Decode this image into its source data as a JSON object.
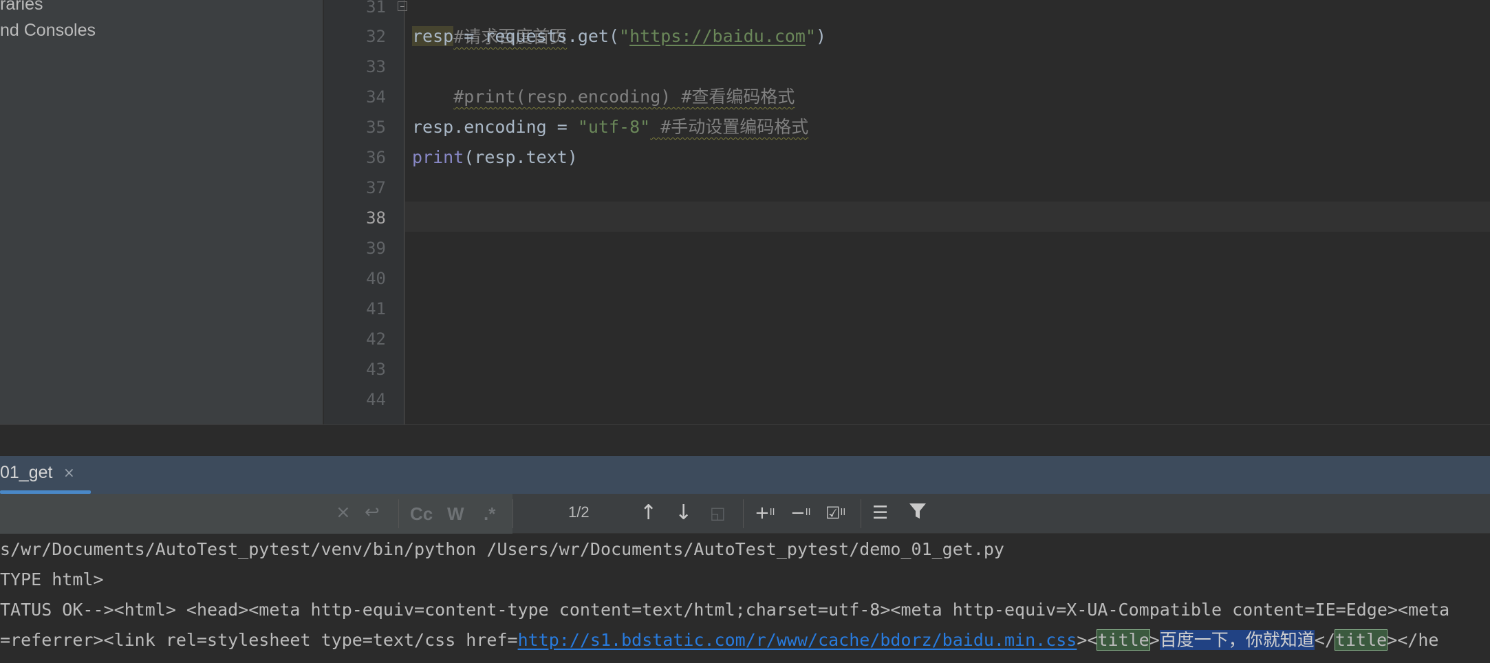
{
  "sidebar": {
    "items": [
      {
        "label": "raries"
      },
      {
        "label": "nd Consoles"
      }
    ]
  },
  "editor": {
    "line_numbers": [
      "31",
      "32",
      "33",
      "34",
      "35",
      "36",
      "37",
      "38",
      "39",
      "40",
      "41",
      "42",
      "43",
      "44"
    ],
    "current_line": "38",
    "lines": {
      "l31": {
        "comment": "#请求百度首页"
      },
      "l32": {
        "var": "resp",
        "assign": " = requests.get(",
        "q1": "\"",
        "url": "https://baidu.com",
        "q2": "\"",
        "close": ")"
      },
      "l33": {
        "comment": "#print(resp.encoding) #查看编码格式"
      },
      "l35": {
        "code": "resp.encoding = ",
        "str": "\"utf-8\"",
        "comment": " #手动设置编码格式"
      },
      "l36": {
        "builtin": "print",
        "rest": "(resp.text)"
      }
    }
  },
  "run": {
    "tab_label": "01_get",
    "tab_close": "×",
    "search": {
      "clear_icon": "×",
      "wrap_icon": "↩",
      "match_case": "Cc",
      "words": "W",
      "regex": ".*",
      "match_count": "1/2"
    },
    "toolbar": {
      "prev_icon": "arrow-up-icon",
      "next_icon": "arrow-down-icon",
      "select_all_icon": "select-occurrence-icon",
      "add_sel_icon": "add-selection-icon",
      "remove_sel_icon": "remove-selection-icon",
      "select_all_occ_icon": "select-all-occurrences-icon",
      "multiline_icon": "multiline-icon",
      "filter_icon": "filter-icon"
    },
    "console": {
      "line1": "s/wr/Documents/AutoTest_pytest/venv/bin/python /Users/wr/Documents/AutoTest_pytest/demo_01_get.py",
      "line2": "TYPE html>",
      "line3": "TATUS OK--><html> <head><meta http-equiv=content-type content=text/html;charset=utf-8><meta http-equiv=X-UA-Compatible content=IE=Edge><meta",
      "line4_pre": "=referrer><link rel=stylesheet type=text/css href=",
      "line4_link": "http://s1.bdstatic.com/r/www/cache/bdorz/baidu.min.css",
      "line4_lt": "><",
      "line4_tag1": "title",
      "line4_gt": ">",
      "line4_sel": "百度一下，你就知道",
      "line4_lt2": "</",
      "line4_tag2": "title",
      "line4_end": "></he"
    }
  },
  "colors": {
    "editor_bg": "#2b2b2b",
    "gutter_bg": "#313335",
    "sidebar_bg": "#3c3f41",
    "run_header_bg": "#3d4b5c",
    "accent": "#4a88c7",
    "string": "#6a8759",
    "comment": "#808080",
    "link": "#287bde"
  }
}
